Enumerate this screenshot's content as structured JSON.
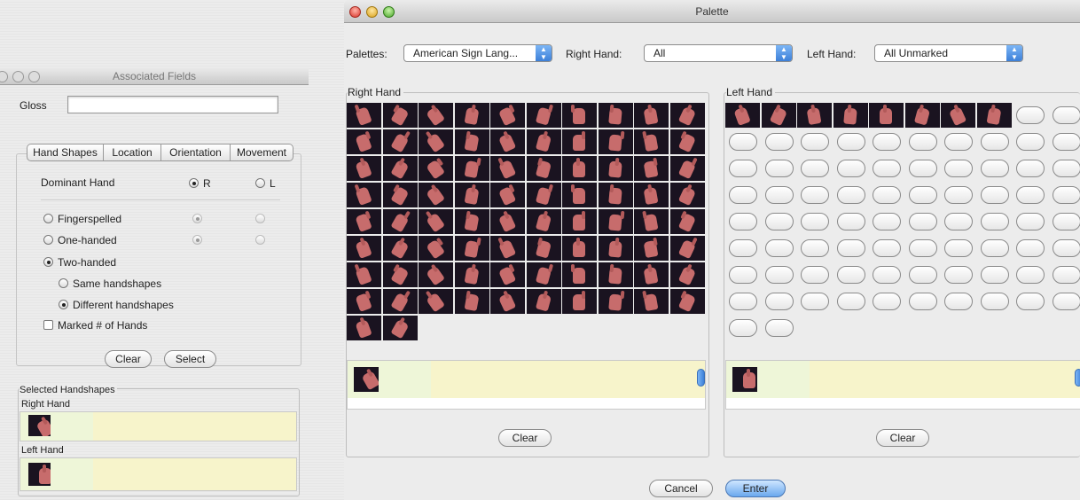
{
  "associated": {
    "title": "Associated Fields",
    "gloss_label": "Gloss",
    "gloss_value": "",
    "tabs": [
      "Hand Shapes",
      "Location",
      "Orientation",
      "Movement"
    ],
    "dominant_hand_label": "Dominant Hand",
    "dominant_r": "R",
    "dominant_l": "L",
    "options": {
      "fingerspelled": "Fingerspelled",
      "one_handed": "One-handed",
      "two_handed": "Two-handed",
      "same_handshapes": "Same handshapes",
      "different_handshapes": "Different handshapes",
      "marked_hands": "Marked # of Hands"
    },
    "clear_label": "Clear",
    "select_label": "Select",
    "selected_group_title": "Selected Handshapes",
    "selected_right_label": "Right Hand",
    "selected_left_label": "Left Hand"
  },
  "palette": {
    "title": "Palette",
    "palettes_label": "Palettes:",
    "palettes_value": "American Sign Lang...",
    "right_hand_label": "Right Hand:",
    "right_hand_value": "All",
    "left_hand_label": "Left Hand:",
    "left_hand_value": "All Unmarked",
    "right_group_title": "Right Hand",
    "left_group_title": "Left Hand",
    "right_clear_label": "Clear",
    "left_clear_label": "Clear",
    "cancel_label": "Cancel",
    "enter_label": "Enter",
    "right_tile_count": 82,
    "left_filled_count": 8,
    "left_empty_count": 74
  },
  "colors": {
    "accent": "#3c7fd8",
    "tile_bg": "#1a1320",
    "hand": "#c76c6c",
    "selection_bg": "#f7f4cb"
  }
}
